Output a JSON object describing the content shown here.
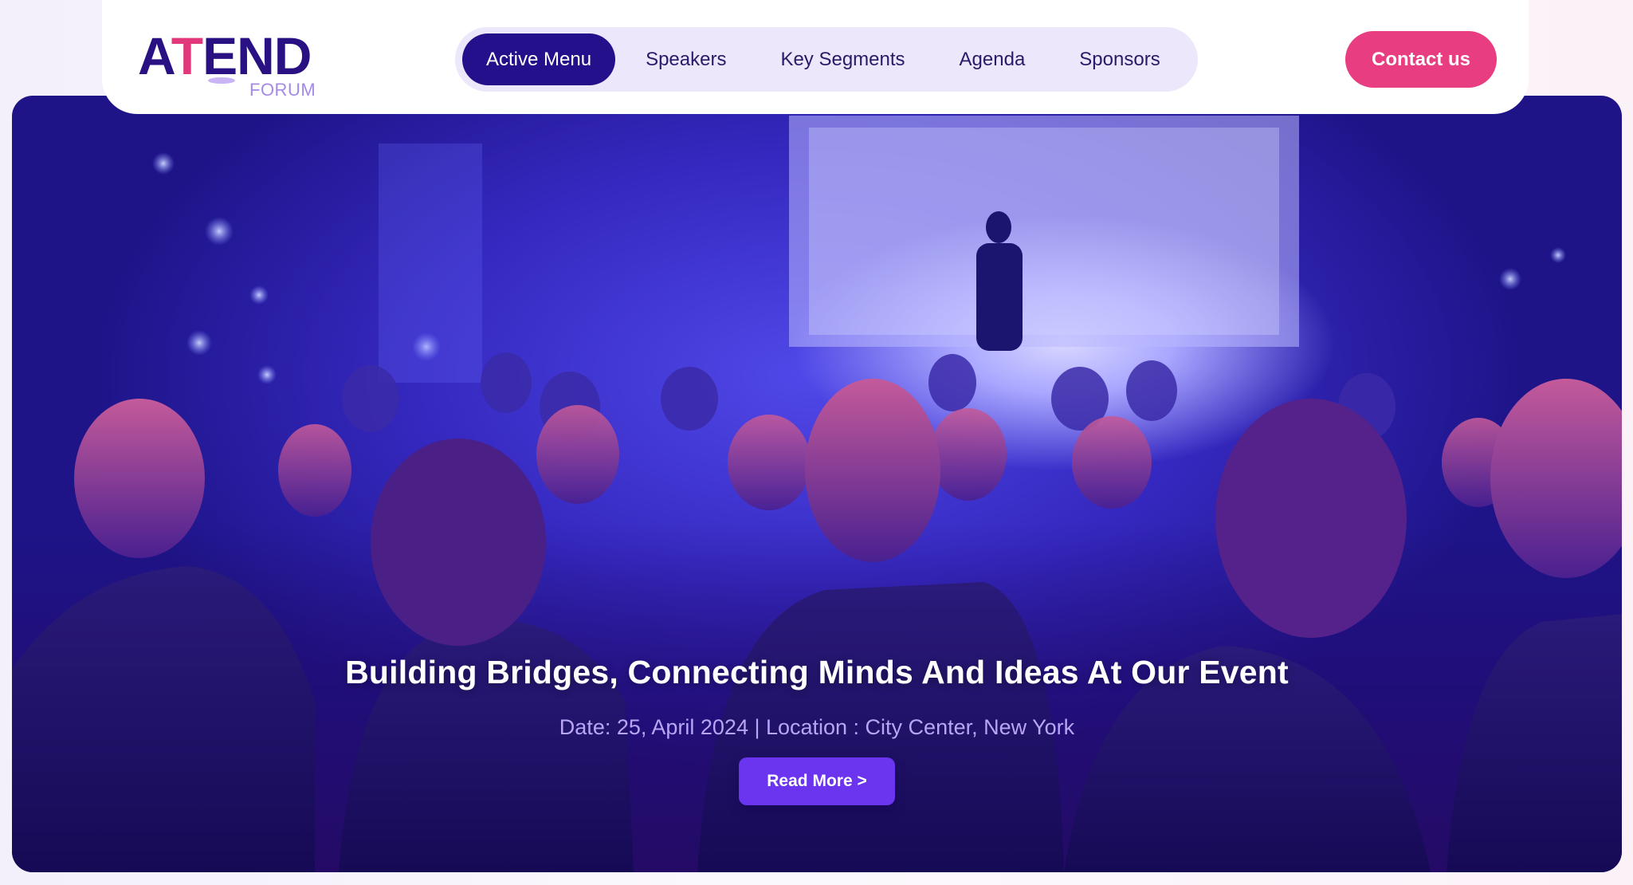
{
  "logo": {
    "primary_a": "A",
    "primary_t": "T",
    "primary_rest": "END",
    "subtitle": "FORUM"
  },
  "nav": {
    "items": [
      {
        "label": "Active Menu",
        "active": true
      },
      {
        "label": "Speakers",
        "active": false
      },
      {
        "label": "Key Segments",
        "active": false
      },
      {
        "label": "Agenda",
        "active": false
      },
      {
        "label": "Sponsors",
        "active": false
      }
    ]
  },
  "header": {
    "contact_label": "Contact us"
  },
  "hero": {
    "title": "Building Bridges, Connecting Minds And Ideas At Our Event",
    "meta": "Date: 25, April 2024 | Location : City Center, New York",
    "cta_label": "Read More >"
  },
  "colors": {
    "brand_dark": "#24108a",
    "accent_pink": "#e83d80",
    "cta_purple": "#6b34ee",
    "nav_bg": "#ede7fb"
  }
}
